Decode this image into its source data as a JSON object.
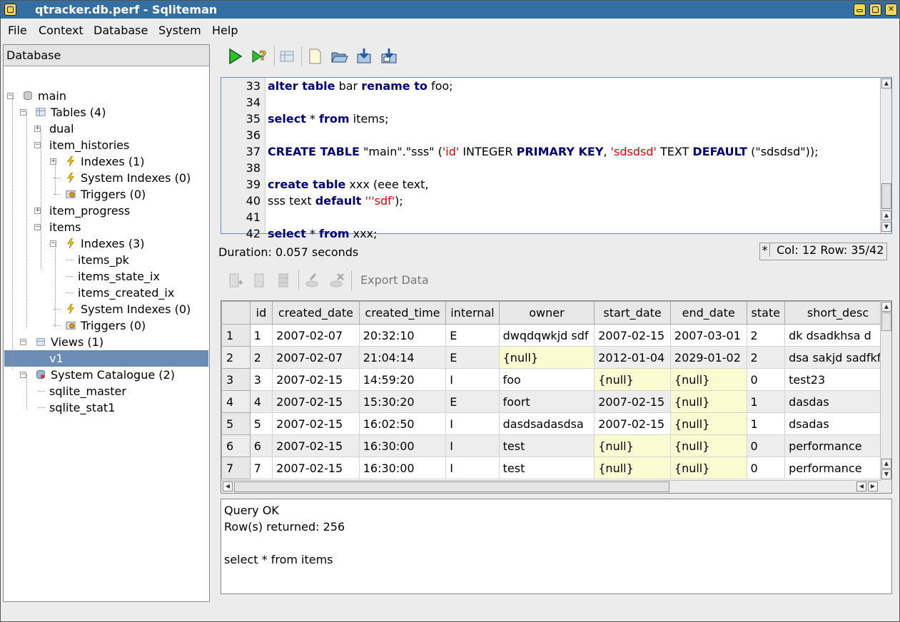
{
  "window": {
    "title": "qtracker.db.perf - Sqliteman"
  },
  "menu": [
    "File",
    "Context",
    "Database",
    "System",
    "Help"
  ],
  "dock": {
    "title": "Database",
    "tree": [
      {
        "label": "main",
        "icon": "database-icon"
      },
      {
        "label": "Tables (4)",
        "icon": "table-icon"
      },
      {
        "label": "dual",
        "icon": ""
      },
      {
        "label": "item_histories",
        "icon": ""
      },
      {
        "label": "Indexes (1)",
        "icon": "lightning-icon"
      },
      {
        "label": "System Indexes (0)",
        "icon": "lightning-icon"
      },
      {
        "label": "Triggers (0)",
        "icon": "trigger-icon"
      },
      {
        "label": "item_progress",
        "icon": ""
      },
      {
        "label": "items",
        "icon": ""
      },
      {
        "label": "Indexes (3)",
        "icon": "lightning-icon"
      },
      {
        "label": "items_pk",
        "icon": ""
      },
      {
        "label": "items_state_ix",
        "icon": ""
      },
      {
        "label": "items_created_ix",
        "icon": ""
      },
      {
        "label": "System Indexes (0)",
        "icon": "lightning-icon"
      },
      {
        "label": "Triggers (0)",
        "icon": "trigger-icon"
      },
      {
        "label": "Views (1)",
        "icon": "view-icon"
      },
      {
        "label": "v1",
        "icon": ""
      },
      {
        "label": "System Catalogue (2)",
        "icon": "catalogue-icon"
      },
      {
        "label": "sqlite_master",
        "icon": ""
      },
      {
        "label": "sqlite_stat1",
        "icon": ""
      }
    ]
  },
  "toolbar": {
    "icons": [
      "run-icon",
      "explain-icon",
      "object-browser-icon",
      "new-file-icon",
      "open-file-icon",
      "save-icon",
      "save-as-icon"
    ]
  },
  "editor": {
    "line_numbers": [
      "33",
      "34",
      "35",
      "36",
      "37",
      "38",
      "39",
      "40",
      "41",
      "42"
    ],
    "lines": [
      [
        {
          "t": "alter table",
          "c": "kw"
        },
        {
          "t": " bar ",
          "c": ""
        },
        {
          "t": "rename to",
          "c": "kw"
        },
        {
          "t": " foo;",
          "c": ""
        }
      ],
      [],
      [
        {
          "t": "select",
          "c": "kw"
        },
        {
          "t": " * ",
          "c": ""
        },
        {
          "t": "from",
          "c": "kw"
        },
        {
          "t": " items;",
          "c": ""
        }
      ],
      [],
      [
        {
          "t": "CREATE TABLE",
          "c": "kw"
        },
        {
          "t": " \"main\".\"sss\" (",
          "c": ""
        },
        {
          "t": "'id'",
          "c": "str"
        },
        {
          "t": " INTEGER ",
          "c": ""
        },
        {
          "t": "PRIMARY KEY",
          "c": "kw"
        },
        {
          "t": ", ",
          "c": ""
        },
        {
          "t": "'sdsdsd'",
          "c": "str"
        },
        {
          "t": " TEXT ",
          "c": ""
        },
        {
          "t": "DEFAULT",
          "c": "kw"
        },
        {
          "t": " (\"sdsdsd\"));",
          "c": ""
        }
      ],
      [],
      [
        {
          "t": "create table",
          "c": "kw"
        },
        {
          "t": " xxx (eee text,",
          "c": ""
        }
      ],
      [
        {
          "t": "sss text ",
          "c": ""
        },
        {
          "t": "default",
          "c": "kw"
        },
        {
          "t": " ",
          "c": ""
        },
        {
          "t": "'''sdf'",
          "c": "str"
        },
        {
          "t": ");",
          "c": ""
        }
      ],
      [],
      [
        {
          "t": "select",
          "c": "kw"
        },
        {
          "t": " * ",
          "c": ""
        },
        {
          "t": "from",
          "c": "kw"
        },
        {
          "t": " xxx;",
          "c": ""
        }
      ]
    ]
  },
  "status": {
    "duration": "Duration: 0.057 seconds",
    "modified": "*",
    "colrow": "Col: 12 Row: 35/42"
  },
  "results_toolbar": {
    "export_label": "Export Data"
  },
  "grid": {
    "columns": [
      "id",
      "created_date",
      "created_time",
      "internal",
      "owner",
      "start_date",
      "end_date",
      "state",
      "short_desc"
    ],
    "rows": [
      [
        "1",
        "1",
        "2007-02-07",
        "20:32:10",
        "E",
        "dwqdqwkjd sdf",
        "2007-02-15",
        "2007-03-01",
        "2",
        "dk dsadkhsa d"
      ],
      [
        "2",
        "2",
        "2007-02-07",
        "21:04:14",
        "E",
        "{null}",
        "2012-01-04",
        "2029-01-02",
        "2",
        "dsa sakjd sadfkf"
      ],
      [
        "3",
        "3",
        "2007-02-15",
        "14:59:20",
        "I",
        "foo",
        "{null}",
        "{null}",
        "0",
        "test23"
      ],
      [
        "4",
        "4",
        "2007-02-15",
        "15:30:20",
        "E",
        "foort",
        "2007-02-15",
        "{null}",
        "1",
        "dasdas"
      ],
      [
        "5",
        "5",
        "2007-02-15",
        "16:02:50",
        "I",
        "dasdsadasdsa",
        "2007-02-15",
        "{null}",
        "1",
        "dsadas"
      ],
      [
        "6",
        "6",
        "2007-02-15",
        "16:30:00",
        "I",
        "test",
        "{null}",
        "{null}",
        "0",
        "performance"
      ],
      [
        "7",
        "7",
        "2007-02-15",
        "16:30:00",
        "I",
        "test",
        "{null}",
        "{null}",
        "0",
        "performance"
      ]
    ]
  },
  "messages": {
    "line1": "Query OK",
    "line2": "Row(s) returned: 256",
    "line3": "select * from items"
  }
}
